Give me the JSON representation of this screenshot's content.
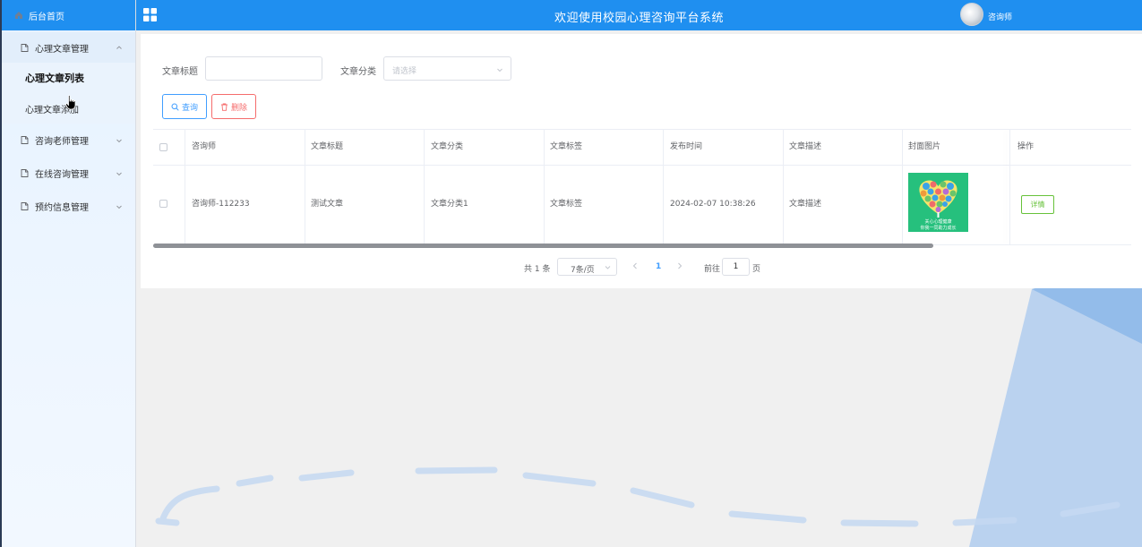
{
  "sidebar": {
    "home_label": "后台首页",
    "groups": [
      {
        "label": "心理文章管理",
        "expanded": true,
        "items": [
          {
            "label": "心理文章列表",
            "active": true
          },
          {
            "label": "心理文章添加",
            "active": false
          }
        ]
      },
      {
        "label": "咨询老师管理",
        "expanded": false
      },
      {
        "label": "在线咨询管理",
        "expanded": false
      },
      {
        "label": "预约信息管理",
        "expanded": false
      }
    ]
  },
  "header": {
    "title": "欢迎使用校园心理咨询平台系统",
    "username": "咨询师"
  },
  "filters": {
    "title_label": "文章标题",
    "title_value": "",
    "category_label": "文章分类",
    "category_placeholder": "请选择"
  },
  "actions": {
    "search_label": "查询",
    "delete_label": "删除"
  },
  "table": {
    "columns": [
      "咨询师",
      "文章标题",
      "文章分类",
      "文章标签",
      "发布时间",
      "文章描述",
      "封面图片",
      "操作"
    ],
    "rows": [
      {
        "counselor": "咨询师-112233",
        "title": "测试文章",
        "category": "文章分类1",
        "tag": "文章标签",
        "published": "2024-02-07 10:38:26",
        "description": "文章描述",
        "cover_caption_1": "关心心理健康",
        "cover_caption_2": "你我一同助力成长",
        "action_label": "详情"
      }
    ]
  },
  "pagination": {
    "total_text": "共 1 条",
    "page_size": "7条/页",
    "current_page": "1",
    "goto_label": "前往",
    "goto_value": "1",
    "page_suffix": "页"
  },
  "colors": {
    "primary": "#1f8ff0",
    "link": "#409eff",
    "danger": "#f56c6c",
    "success": "#67c23a"
  }
}
